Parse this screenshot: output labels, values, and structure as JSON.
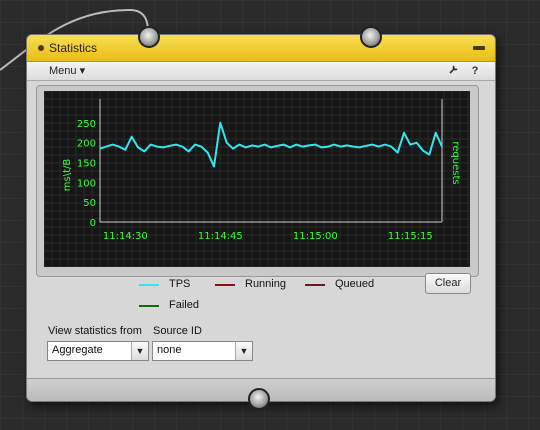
{
  "window": {
    "title": "Statistics"
  },
  "toolbar": {
    "menu_label": "Menu",
    "menu_arrow": "▾",
    "wrench_icon": "wrench-icon",
    "help_label": "?"
  },
  "chart_data": {
    "type": "line",
    "x": [
      "11:14:26",
      "11:14:27",
      "11:14:28",
      "11:14:29",
      "11:14:30",
      "11:14:31",
      "11:14:32",
      "11:14:33",
      "11:14:34",
      "11:14:35",
      "11:14:36",
      "11:14:37",
      "11:14:38",
      "11:14:39",
      "11:14:40",
      "11:14:41",
      "11:14:42",
      "11:14:43",
      "11:14:44",
      "11:14:45",
      "11:14:46",
      "11:14:47",
      "11:14:48",
      "11:14:49",
      "11:14:50",
      "11:14:51",
      "11:14:52",
      "11:14:53",
      "11:14:54",
      "11:14:55",
      "11:14:56",
      "11:14:57",
      "11:14:58",
      "11:14:59",
      "11:15:00",
      "11:15:01",
      "11:15:02",
      "11:15:03",
      "11:15:04",
      "11:15:05",
      "11:15:06",
      "11:15:07",
      "11:15:08",
      "11:15:09",
      "11:15:10",
      "11:15:11",
      "11:15:12",
      "11:15:13",
      "11:15:14",
      "11:15:15",
      "11:15:16",
      "11:15:17",
      "11:15:18",
      "11:15:19",
      "11:15:20"
    ],
    "series": [
      {
        "name": "TPS",
        "color": "#33e6f0",
        "values": [
          185,
          190,
          195,
          190,
          182,
          215,
          188,
          178,
          195,
          190,
          188,
          192,
          195,
          190,
          178,
          195,
          190,
          175,
          140,
          250,
          200,
          185,
          195,
          188,
          193,
          190,
          195,
          188,
          192,
          195,
          188,
          195,
          190,
          193,
          195,
          188,
          190,
          195,
          190,
          193,
          190,
          188,
          192,
          195,
          190,
          195,
          190,
          175,
          225,
          195,
          200,
          180,
          170,
          225,
          190
        ]
      },
      {
        "name": "Running",
        "color": "#8b1111",
        "values": []
      },
      {
        "name": "Queued",
        "color": "#6b1a1a",
        "values": []
      },
      {
        "name": "Failed",
        "color": "#0d6a0d",
        "values": []
      }
    ],
    "xticks": [
      "11:14:30",
      "11:14:45",
      "11:15:00",
      "11:15:15"
    ],
    "yticks": [
      "0",
      "50",
      "100",
      "150",
      "200",
      "250"
    ],
    "ylim": [
      0,
      300
    ],
    "ylabel_left": "ms\\t/B",
    "ylabel_right": "requests",
    "grid": true
  },
  "legend": {
    "tps": "TPS",
    "running": "Running",
    "queued": "Queued",
    "failed": "Failed"
  },
  "controls": {
    "clear_label": "Clear",
    "view_label": "View statistics from",
    "view_value": "Aggregate",
    "source_label": "Source ID",
    "source_value": "none"
  }
}
